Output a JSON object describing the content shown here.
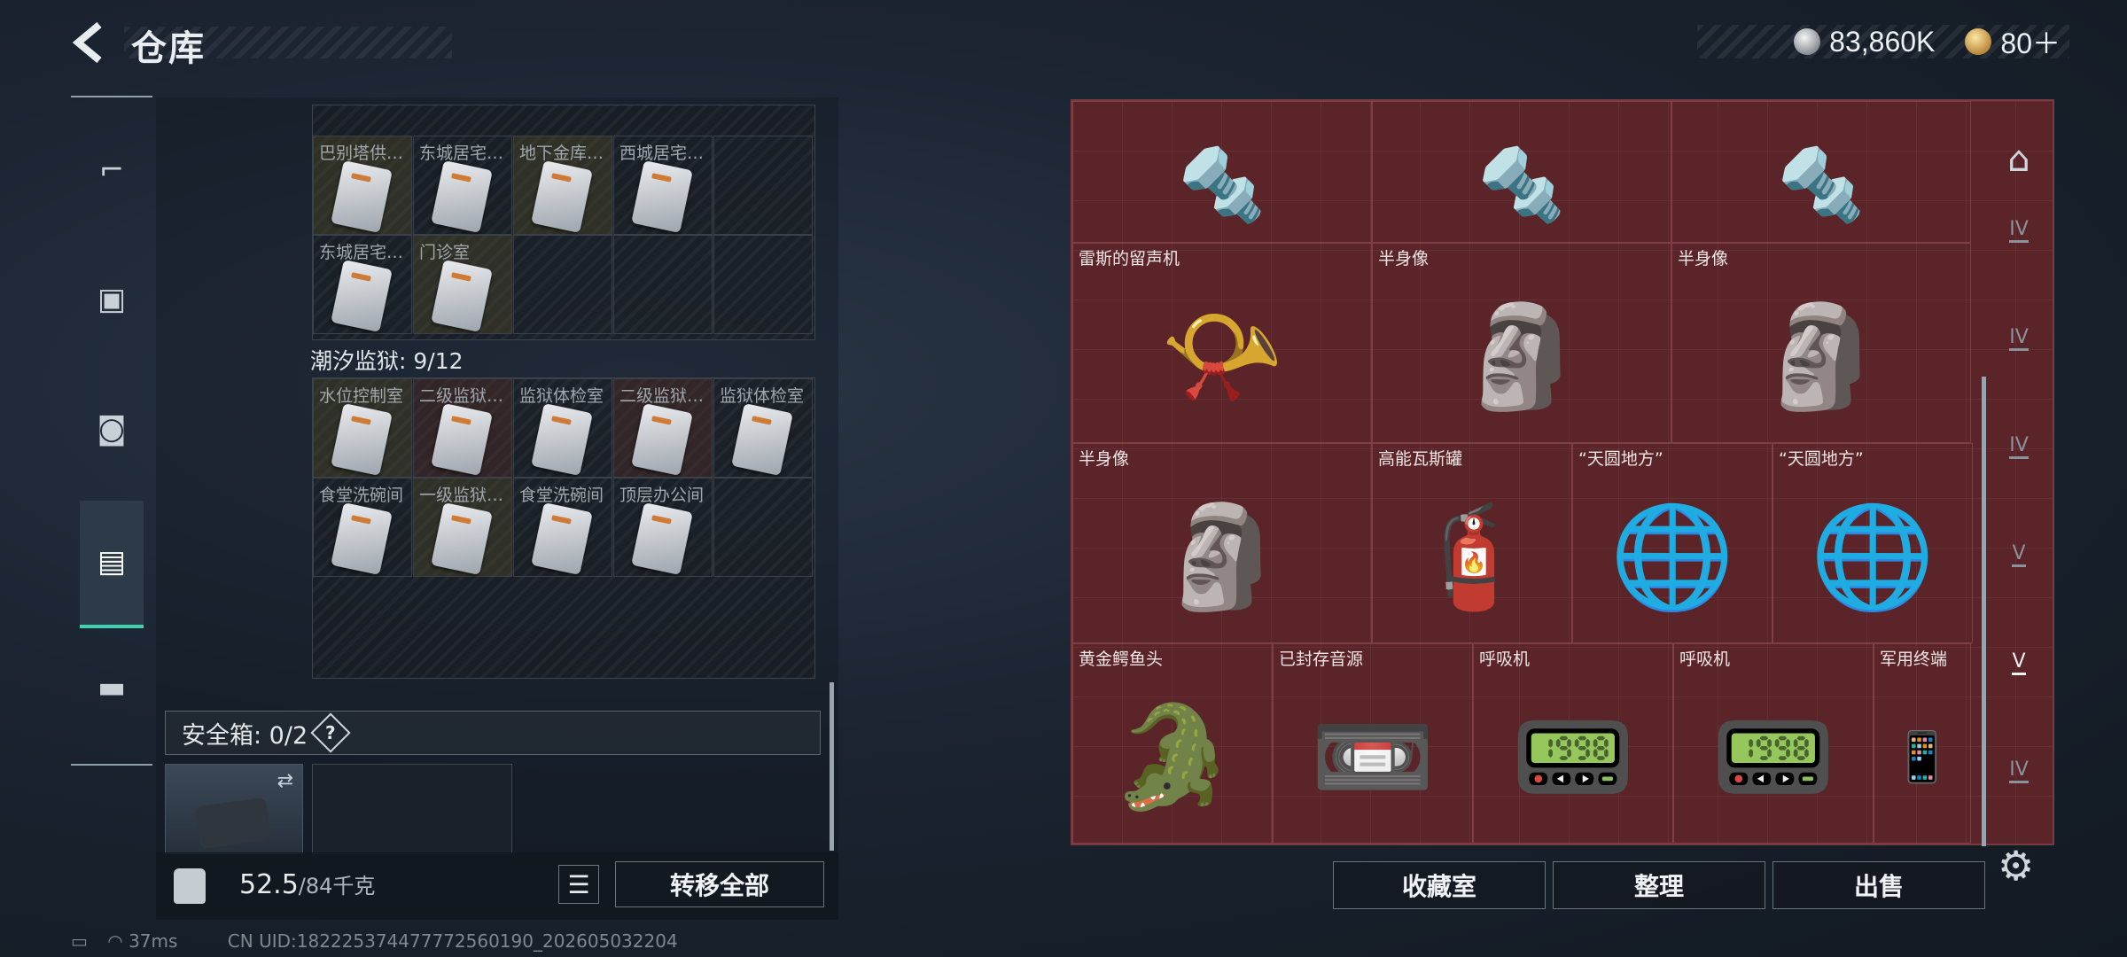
{
  "header": {
    "title": "仓库",
    "silver": "83,860K",
    "gold": "80＋"
  },
  "left": {
    "grid1": [
      [
        "巴别塔供…",
        "东城居宅…",
        "地下金库…",
        "西城居宅…",
        ""
      ],
      [
        "东城居宅…",
        "门诊室",
        "",
        "",
        ""
      ]
    ],
    "section_title": "潮汐监狱: 9/12",
    "grid2": [
      [
        "水位控制室",
        "二级监狱…",
        "监狱体检室",
        "二级监狱…",
        "监狱体检室"
      ],
      [
        "食堂洗碗间",
        "一级监狱…",
        "食堂洗碗间",
        "顶层办公间",
        ""
      ]
    ],
    "safe_label": "安全箱: 0/2",
    "weight_current": "52.5",
    "weight_max": "/84千克",
    "transfer_all": "转移全部"
  },
  "right": {
    "items": [
      {
        "name": "",
        "kind": "arm"
      },
      {
        "name": "",
        "kind": "arm"
      },
      {
        "name": "",
        "kind": "arm"
      },
      {
        "name": "雷斯的留声机",
        "kind": "gramophone"
      },
      {
        "name": "半身像",
        "kind": "bust"
      },
      {
        "name": "半身像",
        "kind": "bust"
      },
      {
        "name": "半身像",
        "kind": "bust"
      },
      {
        "name": "高能瓦斯罐",
        "kind": "gas"
      },
      {
        "name": "“天圆地方”",
        "kind": "globe"
      },
      {
        "name": "“天圆地方”",
        "kind": "globe"
      },
      {
        "name": "黄金鳄鱼头",
        "kind": "croc"
      },
      {
        "name": "已封存音源",
        "kind": "tape"
      },
      {
        "name": "呼吸机",
        "kind": "vent"
      },
      {
        "name": "呼吸机",
        "kind": "vent"
      },
      {
        "name": "军用终端",
        "kind": "terminal"
      }
    ],
    "buttons": {
      "collection": "收藏室",
      "sort": "整理",
      "sell": "出售"
    },
    "rail_labels": [
      "IV",
      "IV",
      "IV",
      "V",
      "V",
      "IV"
    ]
  },
  "footer": {
    "ping": "37ms",
    "uid": "CN UID:182225374477772560190_202605032204"
  },
  "safe_q": "?"
}
